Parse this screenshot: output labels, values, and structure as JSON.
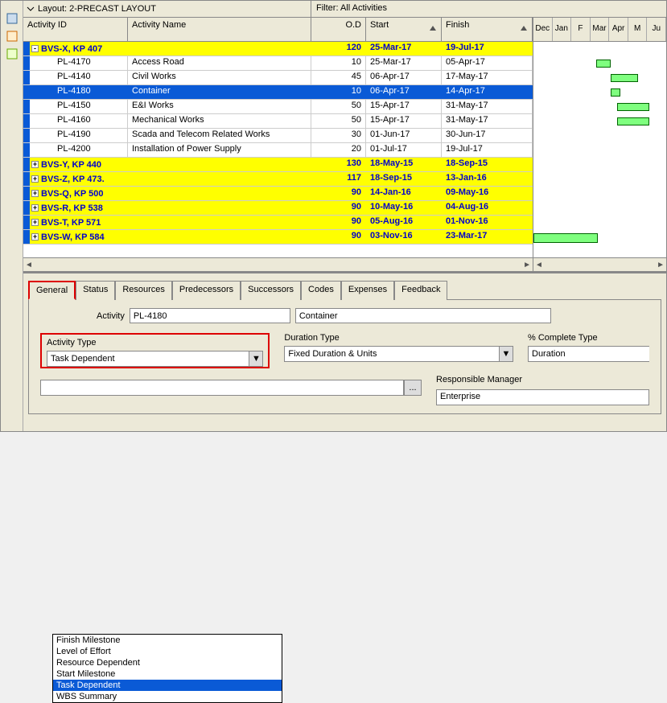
{
  "layout_label": "Layout: 2-PRECAST LAYOUT",
  "filter_label": "Filter: All Activities",
  "headers": {
    "id": "Activity ID",
    "name": "Activity Name",
    "od": "O.D",
    "start": "Start",
    "finish": "Finish"
  },
  "rows": [
    {
      "type": "wbs",
      "exp": "-",
      "id": "BVS-X, KP 407",
      "od": "120",
      "start": "25-Mar-17",
      "finish": "19-Jul-17"
    },
    {
      "type": "act",
      "id": "PL-4170",
      "name": "Access Road",
      "od": "10",
      "start": "25-Mar-17",
      "finish": "05-Apr-17"
    },
    {
      "type": "act",
      "id": "PL-4140",
      "name": "Civil Works",
      "od": "45",
      "start": "06-Apr-17",
      "finish": "17-May-17"
    },
    {
      "type": "act",
      "sel": true,
      "id": "PL-4180",
      "name": "Container",
      "od": "10",
      "start": "06-Apr-17",
      "finish": "14-Apr-17"
    },
    {
      "type": "act",
      "id": "PL-4150",
      "name": "E&I Works",
      "od": "50",
      "start": "15-Apr-17",
      "finish": "31-May-17"
    },
    {
      "type": "act",
      "id": "PL-4160",
      "name": "Mechanical Works",
      "od": "50",
      "start": "15-Apr-17",
      "finish": "31-May-17"
    },
    {
      "type": "act",
      "id": "PL-4190",
      "name": "Scada and Telecom Related Works",
      "od": "30",
      "start": "01-Jun-17",
      "finish": "30-Jun-17"
    },
    {
      "type": "act",
      "id": "PL-4200",
      "name": "Installation of Power Supply",
      "od": "20",
      "start": "01-Jul-17",
      "finish": "19-Jul-17"
    },
    {
      "type": "wbs",
      "exp": "+",
      "id": "BVS-Y, KP 440",
      "od": "130",
      "start": "18-May-15",
      "finish": "18-Sep-15"
    },
    {
      "type": "wbs",
      "exp": "+",
      "id": "BVS-Z, KP 473.",
      "od": "117",
      "start": "18-Sep-15",
      "finish": "13-Jan-16"
    },
    {
      "type": "wbs",
      "exp": "+",
      "id": "BVS-Q, KP 500",
      "od": "90",
      "start": "14-Jan-16",
      "finish": "09-May-16"
    },
    {
      "type": "wbs",
      "exp": "+",
      "id": "BVS-R, KP 538",
      "od": "90",
      "start": "10-May-16",
      "finish": "04-Aug-16"
    },
    {
      "type": "wbs",
      "exp": "+",
      "id": "BVS-T, KP 571",
      "od": "90",
      "start": "05-Aug-16",
      "finish": "01-Nov-16"
    },
    {
      "type": "wbs",
      "exp": "+",
      "id": "BVS-W, KP 584",
      "od": "90",
      "start": "03-Nov-16",
      "finish": "23-Mar-17"
    }
  ],
  "months": [
    "Dec",
    "Jan",
    "F",
    "Mar",
    "Apr",
    "M",
    "Ju"
  ],
  "tabs": [
    "General",
    "Status",
    "Resources",
    "Predecessors",
    "Successors",
    "Codes",
    "Expenses",
    "Feedback"
  ],
  "details": {
    "activity_label": "Activity",
    "activity_id": "PL-4180",
    "activity_name": "Container",
    "activity_type_label": "Activity Type",
    "activity_type_value": "Task Dependent",
    "duration_type_label": "Duration Type",
    "duration_type_value": "Fixed Duration & Units",
    "pct_label": "% Complete Type",
    "pct_value": "Duration",
    "resp_label": "Responsible Manager",
    "resp_value": "Enterprise"
  },
  "dropdown": [
    "Finish Milestone",
    "Level of Effort",
    "Resource Dependent",
    "Start Milestone",
    "Task Dependent",
    "WBS Summary"
  ],
  "dropdown_selected": "Task Dependent"
}
